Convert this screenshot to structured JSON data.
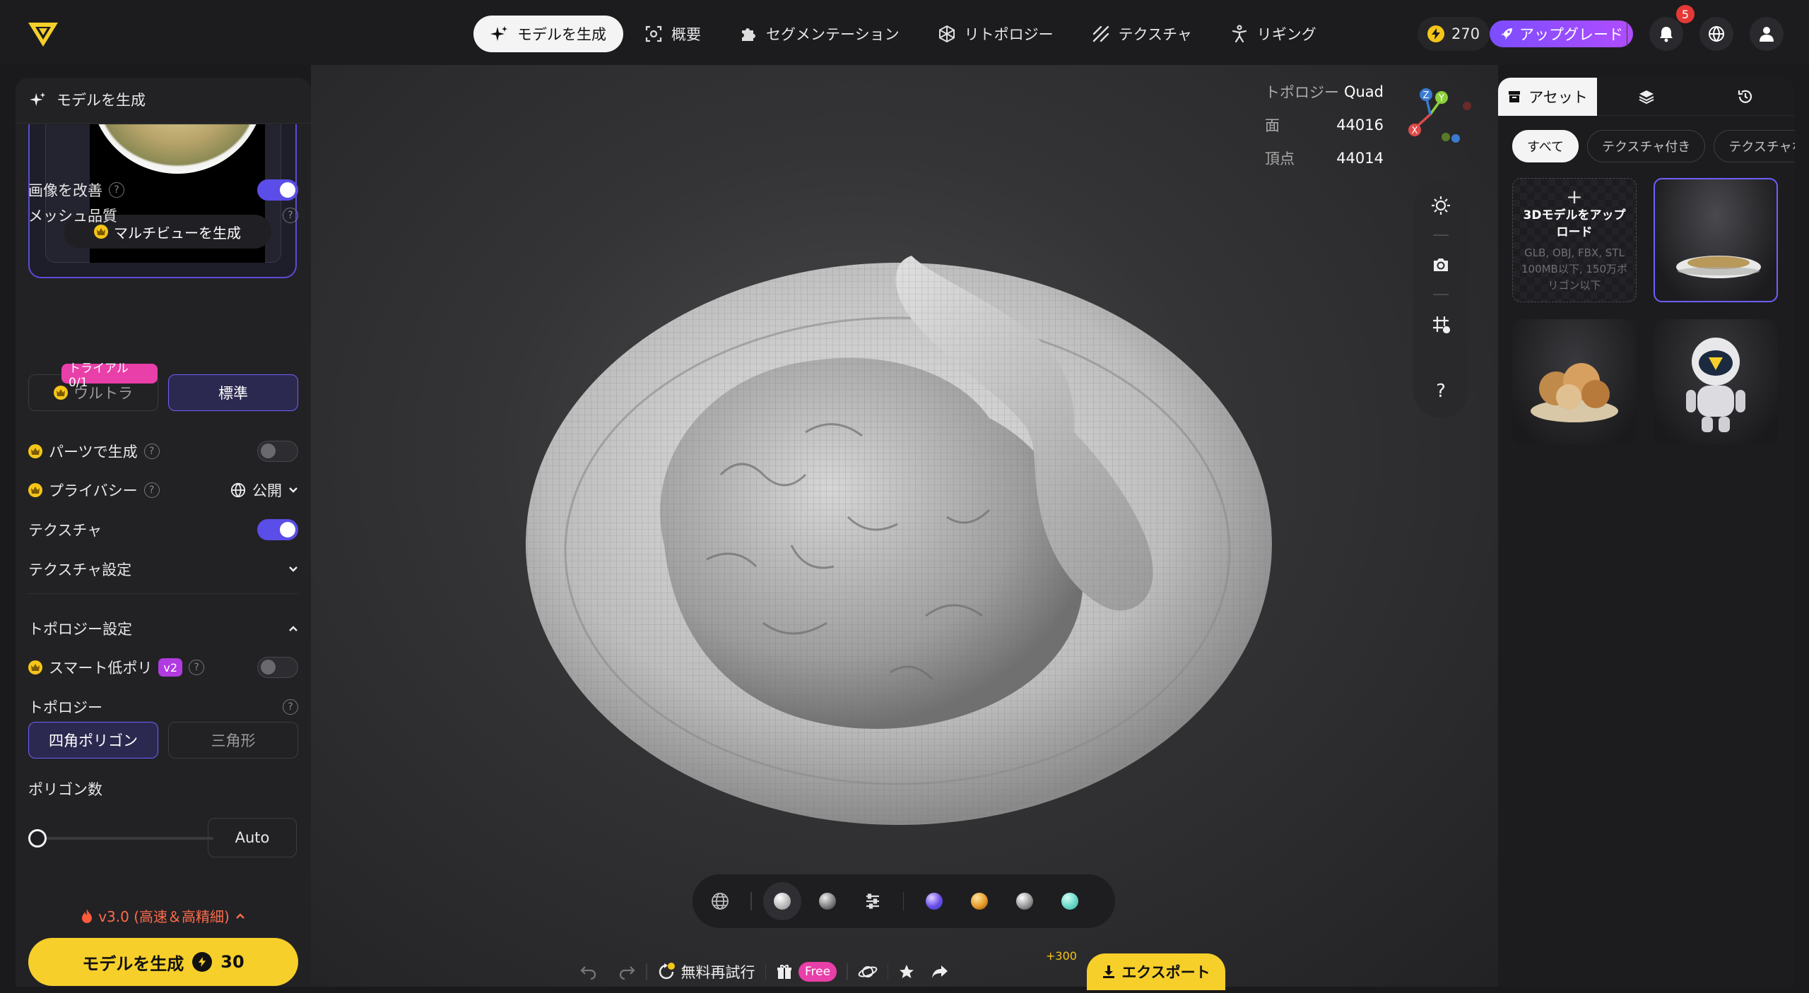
{
  "nav": {
    "items": [
      {
        "label": "モデルを生成",
        "icon": "sparkle-icon",
        "active": true
      },
      {
        "label": "概要",
        "icon": "scan-icon"
      },
      {
        "label": "セグメンテーション",
        "icon": "puzzle-icon"
      },
      {
        "label": "リトポロジー",
        "icon": "mesh-icon"
      },
      {
        "label": "テクスチャ",
        "icon": "hatch-icon"
      },
      {
        "label": "リギング",
        "icon": "figure-icon"
      }
    ]
  },
  "topbar": {
    "credits": "270",
    "upgrade_label": "アップグレード",
    "notification_count": "5"
  },
  "left": {
    "title": "モデルを生成",
    "multiview_label": "マルチビューを生成",
    "improve_image": "画像を改善",
    "mesh_quality": "メッシュ品質",
    "trial_badge": "トライアル 0/1",
    "ultra": "ウルトラ",
    "standard": "標準",
    "parts_generate": "パーツで生成",
    "privacy": "プライバシー",
    "privacy_value": "公開",
    "texture": "テクスチャ",
    "texture_settings": "テクスチャ設定",
    "topology_settings": "トポロジー設定",
    "smart_lowpoly": "スマート低ポリ",
    "smart_lowpoly_badge": "v2",
    "topology": "トポロジー",
    "quad": "四角ポリゴン",
    "triangle": "三角形",
    "poly_count": "ポリゴン数",
    "poly_value": "Auto",
    "version": "v3.0 (高速＆高精細)",
    "generate_label": "モデルを生成",
    "generate_cost": "30"
  },
  "viewport": {
    "stats": [
      {
        "label": "トポロジー",
        "value": "Quad"
      },
      {
        "label": "面",
        "value": "44016"
      },
      {
        "label": "頂点",
        "value": "44014"
      }
    ],
    "axes": {
      "x": "X",
      "y": "Y",
      "z": "Z"
    },
    "help": "?"
  },
  "render_modes": [
    "wireframe-icon",
    "clay-white-icon",
    "clay-gray-icon",
    "adjust-icon",
    "matcap-purple-icon",
    "matcap-orange-icon",
    "matcap-silver-icon",
    "matcap-cyan-icon"
  ],
  "actions": {
    "retry_label": "無料再試行",
    "free_badge": "Free",
    "bonus": "+300",
    "export_label": "エクスポート"
  },
  "right": {
    "tabs": [
      "アセット",
      "layers-icon",
      "history-icon"
    ],
    "filters": [
      "すべて",
      "テクスチャ付き",
      "テクスチャなし"
    ],
    "upload_title": "3Dモデルをアップロード",
    "upload_hint": "GLB, OBJ, FBX, STL 100MB以下, 150万ポリゴン以下"
  },
  "colors": {
    "accent": "#5b4de8",
    "yellow": "#f6cf2a",
    "pink": "#e83fa8"
  }
}
